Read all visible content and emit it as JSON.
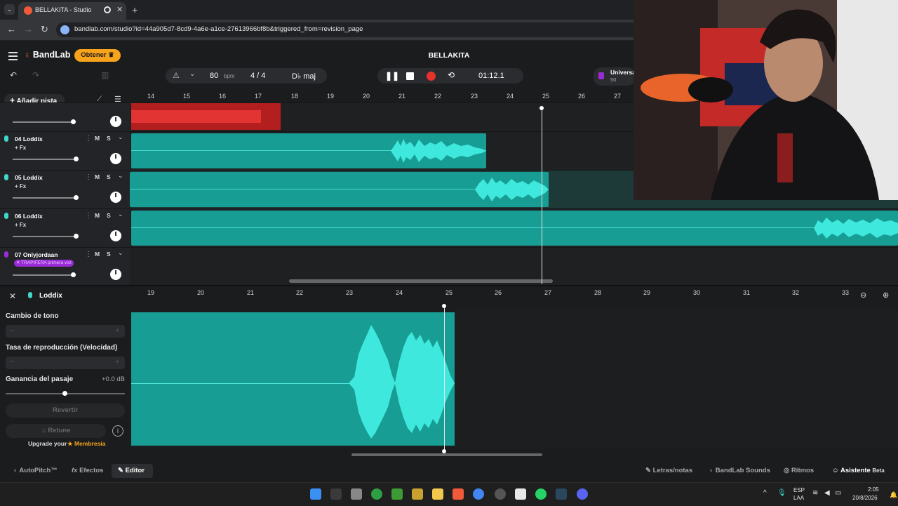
{
  "browser": {
    "tab_title": "BELLAKITA - Studio",
    "tab_close": "✕",
    "new_tab": "+",
    "url": "bandlab.com/studio?id=44a905d7-8cd9-4a6e-a1ce-27613966bf8b&triggered_from=revision_page"
  },
  "header": {
    "logo": "BandLab",
    "obtener": "Obtener",
    "project_title": "BELLAKITA",
    "bpm_value": "80",
    "bpm_unit": "bpm",
    "time_signature": "4 / 4",
    "key": "D♭ maj",
    "time": "01:12.1",
    "universal_label": "Universa",
    "universal_count": "50"
  },
  "toolbar": {
    "add_track": "Añadir pista"
  },
  "ruler_top": [
    "14",
    "15",
    "16",
    "17",
    "18",
    "19",
    "20",
    "21",
    "22",
    "23",
    "24",
    "25",
    "26",
    "27"
  ],
  "tracks": [
    {
      "name": "04 Loddix",
      "fx": "+ Fx",
      "m": "M",
      "s": "S"
    },
    {
      "name": "05 Loddix",
      "fx": "+ Fx",
      "m": "M",
      "s": "S"
    },
    {
      "name": "06 Loddix",
      "fx": "+ Fx",
      "m": "M",
      "s": "S"
    },
    {
      "name": "07 Onlyjordaan",
      "fx": "",
      "m": "M",
      "s": "S",
      "tag": "✕ TRAPIFERA primera voz"
    }
  ],
  "editor": {
    "track_name": "Loddix",
    "ruler": [
      "19",
      "20",
      "21",
      "22",
      "23",
      "24",
      "25",
      "26",
      "27",
      "28",
      "29",
      "30",
      "31",
      "32",
      "33"
    ],
    "pitch_label": "Cambio de tono",
    "speed_label": "Tasa de reproducción (Velocidad)",
    "gain_label": "Ganancia del pasaje",
    "gain_value": "+0.0 dB",
    "revert": "Revertir",
    "retune": "Retune",
    "upgrade_prefix": "Upgrade your",
    "upgrade_link": "Membresía"
  },
  "bottom": {
    "autopitch": "AutoPitch™",
    "efectos": "Efectos",
    "editor": "Editor",
    "letras": "Letras/notas",
    "sounds": "BandLab Sounds",
    "ritmos": "Ritmos",
    "asistente": "Asistente",
    "beta": "Beta"
  },
  "taskbar": {
    "lang_top": "ESP",
    "lang_bottom": "LAA",
    "clock_time": "2:05",
    "clock_date": "20/8/2026",
    "chevron": "^"
  },
  "colors": {
    "accent_teal": "#179d94",
    "wave": "#3fe8dc",
    "record": "#e5322d",
    "obtener": "#f7a31c",
    "bandlab_red": "#f05a38",
    "purple_tag": "#9b2bd6"
  }
}
